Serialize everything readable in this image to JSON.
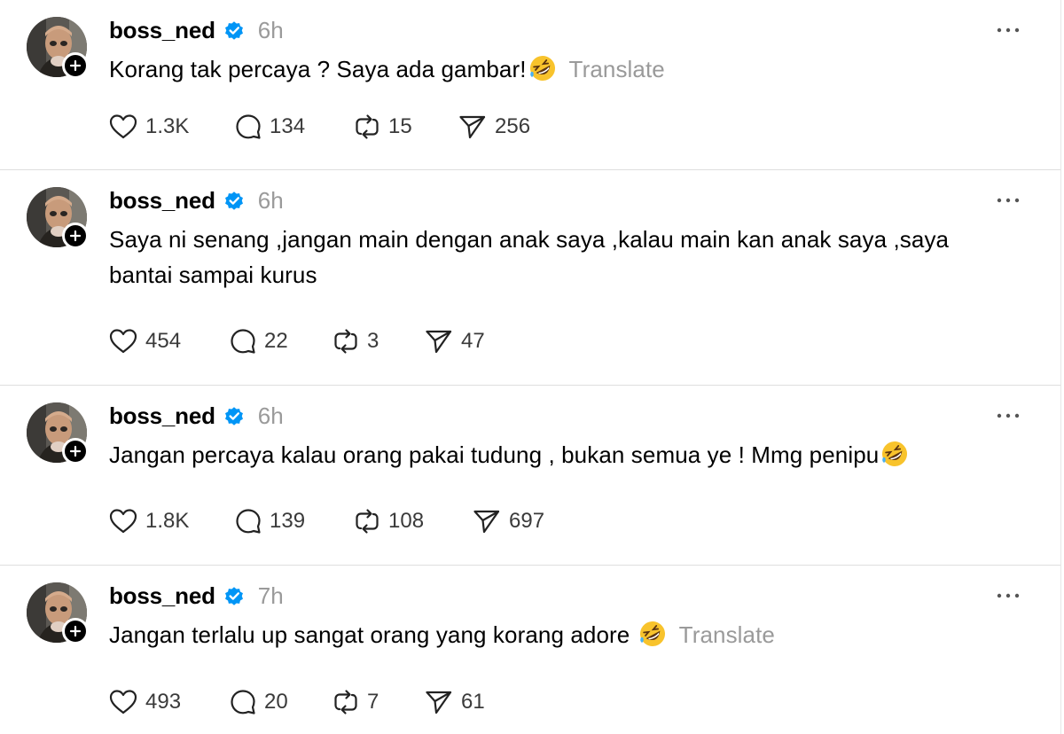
{
  "posts": [
    {
      "username": "boss_ned",
      "time": "6h",
      "text": "Korang tak percaya ? Saya ada gambar!",
      "emoji": "rolling-on-floor-laughing",
      "translate": "Translate",
      "likes": "1.3K",
      "replies": "134",
      "reposts": "15",
      "shares": "256"
    },
    {
      "username": "boss_ned",
      "time": "6h",
      "text_line1": "Saya ni senang ,jangan main dengan anak saya ,kalau main kan anak saya ,saya",
      "text_line2": "bantai sampai kurus",
      "likes": "454",
      "replies": "22",
      "reposts": "3",
      "shares": "47"
    },
    {
      "username": "boss_ned",
      "time": "6h",
      "text": "Jangan percaya kalau orang pakai tudung , bukan semua ye ! Mmg penipu",
      "emoji": "rolling-on-floor-laughing",
      "likes": "1.8K",
      "replies": "139",
      "reposts": "108",
      "shares": "697"
    },
    {
      "username": "boss_ned",
      "time": "7h",
      "text": "Jangan terlalu up sangat orang yang korang adore",
      "emoji": "rolling-on-floor-laughing",
      "translate": "Translate",
      "likes": "493",
      "replies": "20",
      "reposts": "7",
      "shares": "61"
    }
  ],
  "icons": {
    "like": "heart-icon",
    "reply": "comment-icon",
    "repost": "repost-icon",
    "share": "send-icon",
    "verified": "verified-badge-icon",
    "more": "more-options-icon",
    "follow": "plus-icon"
  },
  "colors": {
    "verified_blue": "#0095f6",
    "muted_text": "#9a9a9a",
    "divider": "#dedede"
  }
}
